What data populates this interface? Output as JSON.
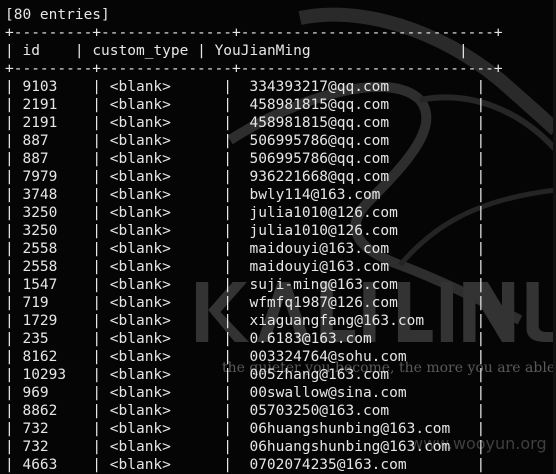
{
  "summary": "[80 entries]",
  "separator": "+---------+---------------+-----------------------------+",
  "columns": [
    "id",
    "custom_type",
    "YouJianMing"
  ],
  "rows": [
    {
      "id": "9103",
      "custom_type": "<blank>",
      "email": "334393217@qq.com"
    },
    {
      "id": "2191",
      "custom_type": "<blank>",
      "email": "458981815@qq.com"
    },
    {
      "id": "2191",
      "custom_type": "<blank>",
      "email": "458981815@qq.com"
    },
    {
      "id": "887",
      "custom_type": "<blank>",
      "email": "506995786@qq.com"
    },
    {
      "id": "887",
      "custom_type": "<blank>",
      "email": "506995786@qq.com"
    },
    {
      "id": "7979",
      "custom_type": "<blank>",
      "email": "936221668@qq.com"
    },
    {
      "id": "3748",
      "custom_type": "<blank>",
      "email": "bwly114@163.com"
    },
    {
      "id": "3250",
      "custom_type": "<blank>",
      "email": "julia1010@126.com"
    },
    {
      "id": "3250",
      "custom_type": "<blank>",
      "email": "julia1010@126.com"
    },
    {
      "id": "2558",
      "custom_type": "<blank>",
      "email": "maidouyi@163.com"
    },
    {
      "id": "2558",
      "custom_type": "<blank>",
      "email": "maidouyi@163.com"
    },
    {
      "id": "1547",
      "custom_type": "<blank>",
      "email": "suji-ming@163.com"
    },
    {
      "id": "719",
      "custom_type": "<blank>",
      "email": "wfmfq1987@126.com"
    },
    {
      "id": "1729",
      "custom_type": "<blank>",
      "email": "xiaguangfang@163.com"
    },
    {
      "id": "235",
      "custom_type": "<blank>",
      "email": "0.6183@163.com"
    },
    {
      "id": "8162",
      "custom_type": "<blank>",
      "email": "003324764@sohu.com"
    },
    {
      "id": "10293",
      "custom_type": "<blank>",
      "email": "005zhang@163.com"
    },
    {
      "id": "969",
      "custom_type": "<blank>",
      "email": "00swallow@sina.com"
    },
    {
      "id": "8862",
      "custom_type": "<blank>",
      "email": "05703250@163.com"
    },
    {
      "id": "732",
      "custom_type": "<blank>",
      "email": "06huangshunbing@163.com"
    },
    {
      "id": "732",
      "custom_type": "<blank>",
      "email": "06huangshunbing@163.com"
    },
    {
      "id": "4663",
      "custom_type": "<blank>",
      "email": "0702074235@163.com"
    }
  ],
  "watermark": {
    "logo_text": "KALI LINUX",
    "tagline": "the quieter you become, the more you are able",
    "url": "www.wooyun.org"
  },
  "colors": {
    "background": "#050505",
    "text": "#e6e6e6",
    "watermark": "#3a3a3a"
  }
}
